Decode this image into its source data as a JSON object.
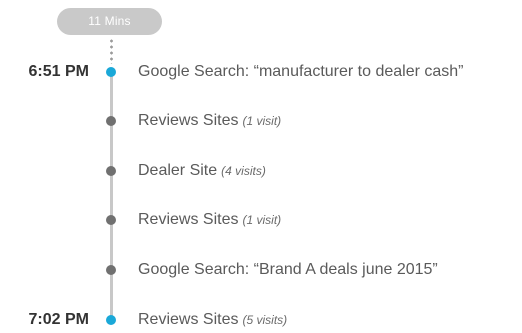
{
  "duration_pill": {
    "label": "11 Mins"
  },
  "colors": {
    "accent_dot": "#1aa8d8",
    "neutral_dot": "#707070",
    "line": "#c8c8c8",
    "pill": "#c9c9c9"
  },
  "events": [
    {
      "time": "6:51 PM",
      "label": "Google Search: “manufacturer to dealer cash”",
      "visits": "",
      "dot": "accent"
    },
    {
      "time": "",
      "label": "Reviews Sites",
      "visits": "(1 visit)",
      "dot": "neutral"
    },
    {
      "time": "",
      "label": "Dealer Site",
      "visits": "(4 visits)",
      "dot": "neutral"
    },
    {
      "time": "",
      "label": "Reviews Sites",
      "visits": "(1 visit)",
      "dot": "neutral"
    },
    {
      "time": "",
      "label": "Google Search: “Brand A deals june 2015”",
      "visits": "",
      "dot": "neutral"
    },
    {
      "time": "7:02 PM",
      "label": "Reviews Sites",
      "visits": "(5 visits)",
      "dot": "accent"
    }
  ]
}
